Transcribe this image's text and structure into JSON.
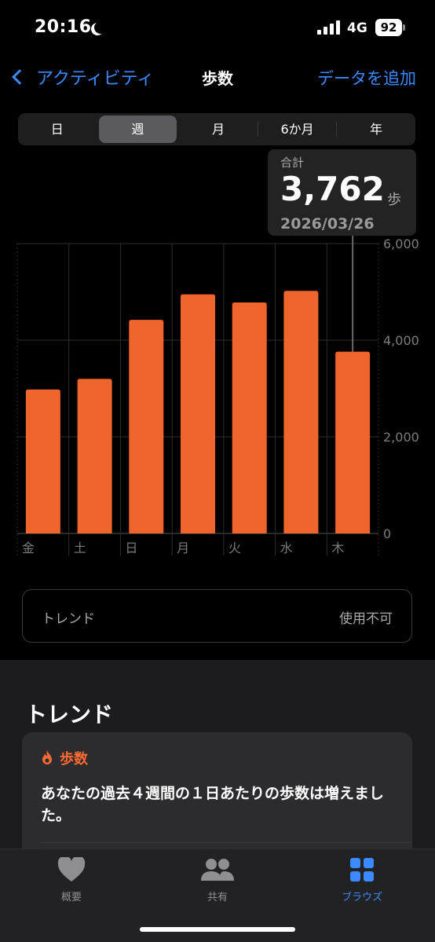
{
  "status": {
    "time": "20:16",
    "network": "4G",
    "battery": "92"
  },
  "nav": {
    "back_label": "アクティビティ",
    "title": "歩数",
    "add_label": "データを追加"
  },
  "segments": [
    {
      "label": "日",
      "active": false
    },
    {
      "label": "週",
      "active": true
    },
    {
      "label": "月",
      "active": false
    },
    {
      "label": "6か月",
      "active": false
    },
    {
      "label": "年",
      "active": false
    }
  ],
  "tooltip": {
    "label": "合計",
    "value": "3,762",
    "unit": "歩",
    "date": "2026/03/26"
  },
  "chart_data": {
    "type": "bar",
    "categories": [
      "金",
      "土",
      "日",
      "月",
      "火",
      "水",
      "木"
    ],
    "values": [
      2980,
      3200,
      4420,
      4950,
      4780,
      5020,
      3762
    ],
    "ylim": [
      0,
      6000
    ],
    "yticks": [
      "0",
      "2,000",
      "4,000",
      "6,000"
    ],
    "yticks_values": [
      0,
      2000,
      4000,
      6000
    ],
    "grid": true,
    "bar_color": "#f0652e",
    "highlight_index": 6
  },
  "trend_row": {
    "label": "トレンド",
    "value": "使用不可"
  },
  "lower": {
    "title": "トレンド",
    "card_head": "歩数",
    "card_text": "あなたの過去４週間の１日あたりの歩数は増えました。"
  },
  "tabs": [
    {
      "label": "概要",
      "icon": "heart-icon",
      "active": false
    },
    {
      "label": "共有",
      "icon": "people-icon",
      "active": false
    },
    {
      "label": "ブラウズ",
      "icon": "grid-icon",
      "active": true
    }
  ],
  "colors": {
    "accent": "#3b8aff",
    "orange": "#f0652e"
  }
}
